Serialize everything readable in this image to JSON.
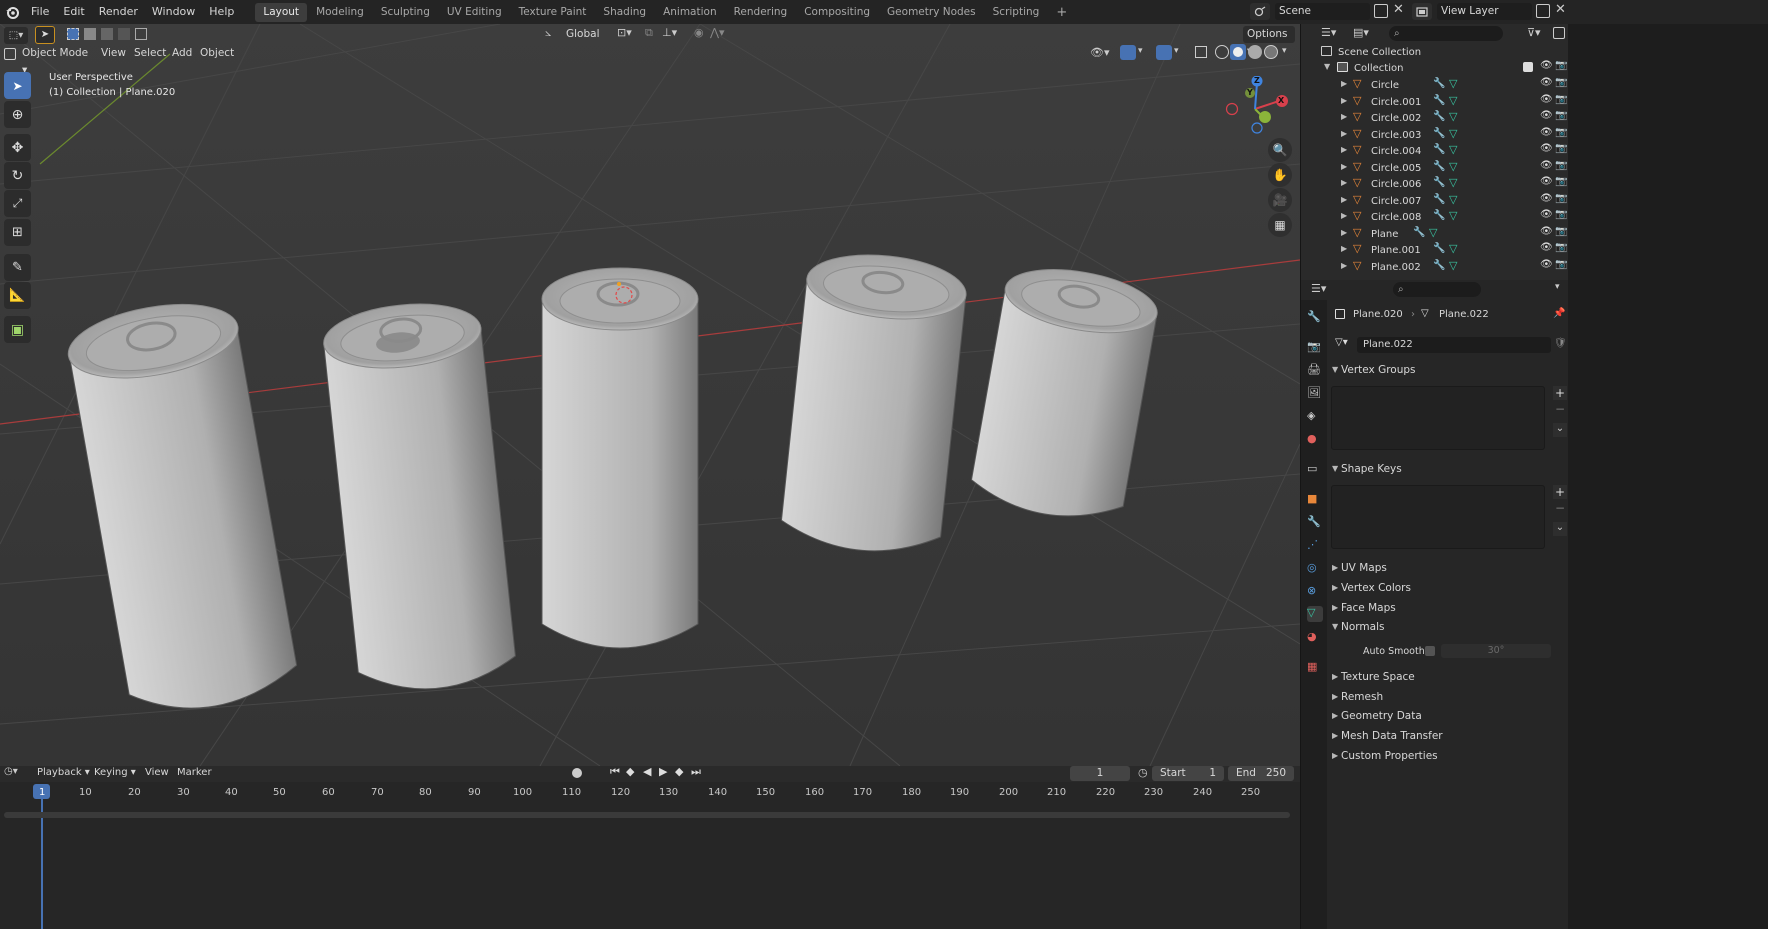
{
  "topbar": {
    "menus": [
      "File",
      "Edit",
      "Render",
      "Window",
      "Help"
    ],
    "workspaces": [
      "Layout",
      "Modeling",
      "Sculpting",
      "UV Editing",
      "Texture Paint",
      "Shading",
      "Animation",
      "Rendering",
      "Compositing",
      "Geometry Nodes",
      "Scripting"
    ],
    "add_workspace": "+",
    "scene": "Scene",
    "view_layer": "View Layer"
  },
  "viewport": {
    "mode": "Object Mode",
    "menus": [
      "View",
      "Select",
      "Add",
      "Object"
    ],
    "orientation": "Global",
    "options_label": "Options",
    "perspective_label": "User Perspective",
    "collection_label": "(1) Collection | Plane.020",
    "gizmo_axes": [
      "X",
      "Y",
      "Z"
    ]
  },
  "timeline": {
    "menus": [
      "Playback",
      "Keying",
      "View",
      "Marker"
    ],
    "current_frame": "1",
    "start_label": "Start",
    "start_value": "1",
    "end_label": "End",
    "end_value": "250",
    "ruler": [
      "1",
      "10",
      "20",
      "30",
      "40",
      "50",
      "60",
      "70",
      "80",
      "90",
      "100",
      "110",
      "120",
      "130",
      "140",
      "150",
      "160",
      "170",
      "180",
      "190",
      "200",
      "210",
      "220",
      "230",
      "240",
      "250"
    ]
  },
  "outliner": {
    "root": "Scene Collection",
    "collection": "Collection",
    "items": [
      "Circle",
      "Circle.001",
      "Circle.002",
      "Circle.003",
      "Circle.004",
      "Circle.005",
      "Circle.006",
      "Circle.007",
      "Circle.008",
      "Plane",
      "Plane.001",
      "Plane.002"
    ]
  },
  "properties": {
    "object_name": "Plane.020",
    "mesh_name": "Plane.022",
    "datablock_name": "Plane.022",
    "panels": {
      "vertex_groups": "Vertex Groups",
      "shape_keys": "Shape Keys",
      "uv_maps": "UV Maps",
      "vertex_colors": "Vertex Colors",
      "face_maps": "Face Maps",
      "normals": "Normals",
      "auto_smooth": "Auto Smooth",
      "auto_smooth_angle": "30°",
      "texture_space": "Texture Space",
      "remesh": "Remesh",
      "geometry_data": "Geometry Data",
      "mesh_data_transfer": "Mesh Data Transfer",
      "custom_properties": "Custom Properties"
    }
  },
  "colors": {
    "accent": "#4772b3",
    "mesh_icon": "#39c5a3",
    "object_icon": "#e8873a",
    "x_axis": "#d8404c",
    "y_axis": "#8bb43a",
    "z_axis": "#3f84e0"
  }
}
